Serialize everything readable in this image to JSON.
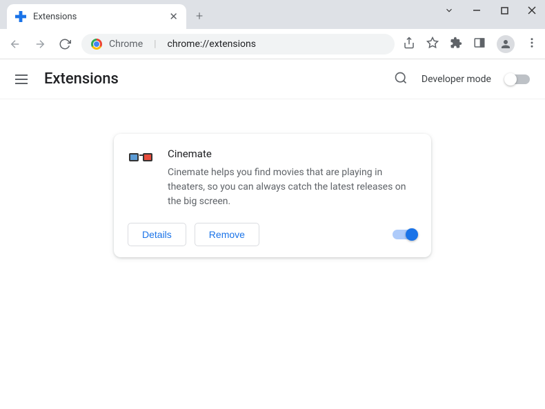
{
  "tab": {
    "title": "Extensions"
  },
  "omnibox": {
    "scheme": "Chrome",
    "path": "chrome://extensions"
  },
  "header": {
    "title": "Extensions",
    "dev_mode_label": "Developer mode"
  },
  "extension": {
    "name": "Cinemate",
    "description": "Cinemate helps you find movies that are playing in theaters, so you can always catch the latest releases on the big screen.",
    "details_label": "Details",
    "remove_label": "Remove",
    "enabled": true
  }
}
